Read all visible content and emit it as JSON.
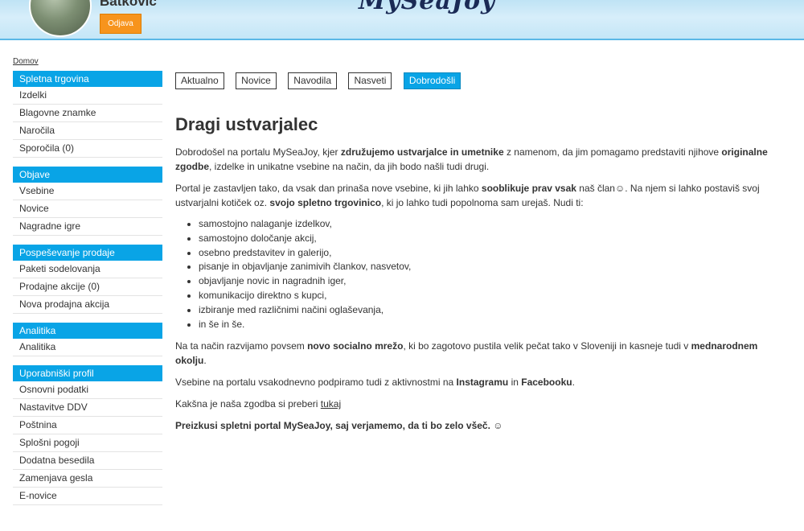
{
  "header": {
    "user_name": "Batkovič",
    "logout_label": "Odjava",
    "logo_text": "MySeaJoy"
  },
  "breadcrumb": "Domov",
  "sidebar": {
    "groups": [
      {
        "title": "Spletna trgovina",
        "items": [
          "Izdelki",
          "Blagovne znamke",
          "Naročila",
          "Sporočila (0)"
        ]
      },
      {
        "title": "Objave",
        "items": [
          "Vsebine",
          "Novice",
          "Nagradne igre"
        ]
      },
      {
        "title": "Pospeševanje prodaje",
        "items": [
          "Paketi sodelovanja",
          "Prodajne akcije (0)",
          "Nova prodajna akcija"
        ]
      },
      {
        "title": "Analitika",
        "items": [
          "Analitika"
        ]
      },
      {
        "title": "Uporabniški profil",
        "items": [
          "Osnovni podatki",
          "Nastavitve DDV",
          "Poštnina",
          "Splošni pogoji",
          "Dodatna besedila",
          "Zamenjava gesla",
          "E-novice"
        ]
      }
    ]
  },
  "tabs": [
    "Aktualno",
    "Novice",
    "Navodila",
    "Nasveti",
    "Dobrodošli"
  ],
  "active_tab": "Dobrodošli",
  "colors": {
    "accent": "#09a4e6",
    "logout": "#f7941d"
  },
  "content": {
    "title": "Dragi ustvarjalec",
    "p1": {
      "a": "Dobrodošel na portalu MySeaJoy, kjer ",
      "b": "združujemo ustvarjalce in umetnike",
      "c": " z namenom, da jim pomagamo predstaviti njihove ",
      "d": "originalne zgodbe",
      "e": ", izdelke in unikatne vsebine na način, da jih bodo našli tudi drugi."
    },
    "p2": {
      "a": "Portal je zastavljen tako, da vsak dan prinaša nove vsebine, ki jih lahko ",
      "b": "sooblikuje prav vsak",
      "c": " naš član☺. Na njem si lahko postaviš svoj ustvarjalni kotiček oz. ",
      "d": "svojo spletno trgovinico",
      "e": ", ki jo lahko tudi popolnoma sam urejaš. Nudi ti:"
    },
    "list": [
      "samostojno nalaganje izdelkov,",
      "samostojno določanje akcij,",
      "osebno predstavitev in galerijo,",
      "pisanje in objavljanje zanimivih člankov, nasvetov,",
      "objavljanje novic in nagradnih iger,",
      "komunikacijo direktno s kupci,",
      "izbiranje med različnimi načini oglaševanja,",
      "in še in še."
    ],
    "p3": {
      "a": "Na ta način razvijamo povsem ",
      "b": "novo socialno mrežo",
      "c": ", ki bo zagotovo pustila velik pečat tako v Sloveniji in kasneje tudi v ",
      "d": "mednarodnem okolju",
      "e": "."
    },
    "p4": {
      "a": "Vsebine na portalu vsakodnevno podpiramo tudi z aktivnostmi na ",
      "b": "Instagramu",
      "c": " in ",
      "d": "Facebooku",
      "e": "."
    },
    "p5": {
      "a": "Kakšna je naša zgodba si preberi ",
      "link": "tukaj"
    },
    "p6": "Preizkusi spletni portal MySeaJoy, saj verjamemo, da ti bo zelo všeč. ☺"
  }
}
